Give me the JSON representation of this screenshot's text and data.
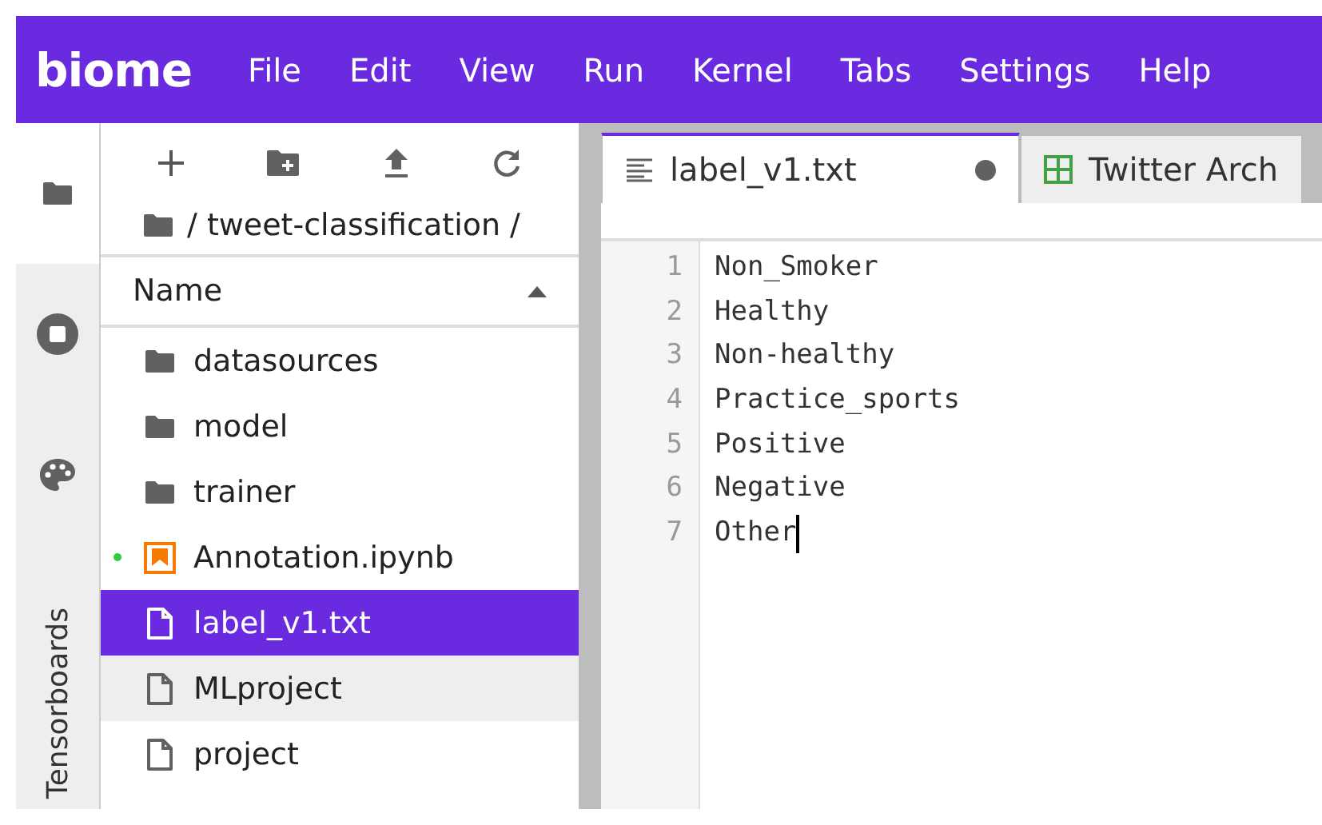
{
  "menubar": {
    "logo": "biome",
    "items": [
      "File",
      "Edit",
      "View",
      "Run",
      "Kernel",
      "Tabs",
      "Settings",
      "Help"
    ]
  },
  "sidebar": {
    "tabs": [
      {
        "kind": "folder",
        "selected": true
      },
      {
        "kind": "stop",
        "selected": false
      },
      {
        "kind": "palette",
        "selected": false
      }
    ],
    "vertical_tab": "Tensorboards"
  },
  "file_browser": {
    "breadcrumb": "/ tweet-classification /",
    "column": "Name",
    "items": [
      {
        "kind": "folder",
        "name": "datasources",
        "selected": false,
        "hovered": false,
        "running": false
      },
      {
        "kind": "folder",
        "name": "model",
        "selected": false,
        "hovered": false,
        "running": false
      },
      {
        "kind": "folder",
        "name": "trainer",
        "selected": false,
        "hovered": false,
        "running": false
      },
      {
        "kind": "notebook",
        "name": "Annotation.ipynb",
        "selected": false,
        "hovered": false,
        "running": true
      },
      {
        "kind": "file",
        "name": "label_v1.txt",
        "selected": true,
        "hovered": false,
        "running": false
      },
      {
        "kind": "file",
        "name": "MLproject",
        "selected": false,
        "hovered": true,
        "running": false
      },
      {
        "kind": "file",
        "name": "project",
        "selected": false,
        "hovered": false,
        "running": false
      }
    ]
  },
  "editor": {
    "tabs": [
      {
        "kind": "text",
        "label": "label_v1.txt",
        "selected": true,
        "modified": true
      },
      {
        "kind": "table",
        "label": "Twitter Arch",
        "selected": false,
        "modified": false
      }
    ],
    "lines": [
      {
        "number": "1",
        "text": "Non_Smoker",
        "cursor": false
      },
      {
        "number": "2",
        "text": "Healthy",
        "cursor": false
      },
      {
        "number": "3",
        "text": "Non-healthy",
        "cursor": false
      },
      {
        "number": "4",
        "text": "Practice_sports",
        "cursor": false
      },
      {
        "number": "5",
        "text": "Positive",
        "cursor": false
      },
      {
        "number": "6",
        "text": "Negative",
        "cursor": false
      },
      {
        "number": "7",
        "text": "Other",
        "cursor": true
      }
    ]
  }
}
